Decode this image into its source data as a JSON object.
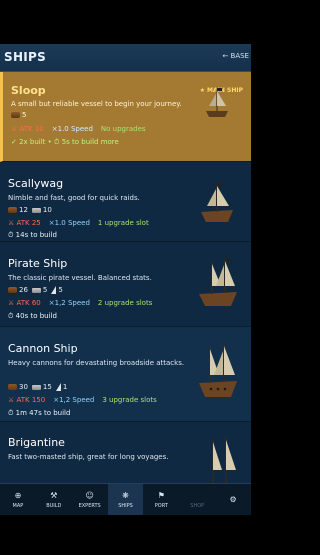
{
  "header": {
    "title": "SHIPS",
    "back_label": "← BASE"
  },
  "ships": [
    {
      "name": "Sloop",
      "badge": "★ MAIN SHIP",
      "description": "A small but reliable vessel to begin your journey.",
      "resources": [
        {
          "type": "log",
          "icon": "log-icon",
          "amount": "5"
        }
      ],
      "atk": "⚔ ATK  10",
      "speed": "×1.0 Speed",
      "upgrades": "No upgrades",
      "build": "✓ 2x built • ⏱ 5s to build more"
    },
    {
      "name": "Scallywag",
      "description": "Nimble and fast, good for quick raids.",
      "resources": [
        {
          "type": "log",
          "icon": "log-icon",
          "amount": "12"
        },
        {
          "type": "plank",
          "icon": "plank-icon",
          "amount": "10"
        }
      ],
      "atk": "⚔ ATK  25",
      "speed": "×1.0 Speed",
      "upgrades": "1 upgrade slot",
      "build": "⏱ 14s to build"
    },
    {
      "name": "Pirate Ship",
      "description": "The classic pirate vessel. Balanced stats.",
      "resources": [
        {
          "type": "log",
          "icon": "log-icon",
          "amount": "26"
        },
        {
          "type": "plank",
          "icon": "plank-icon",
          "amount": "5"
        },
        {
          "type": "sail",
          "icon": "sail-icon",
          "amount": "5"
        }
      ],
      "atk": "⚔ ATK  60",
      "speed": "×1,2 Speed",
      "upgrades": "2 upgrade slots",
      "build": "⏱ 40s to build"
    },
    {
      "name": "Cannon Ship",
      "description": "Heavy cannons for devastating broadside attacks.",
      "resources": [
        {
          "type": "log",
          "icon": "log-icon",
          "amount": "30"
        },
        {
          "type": "plank",
          "icon": "plank-icon",
          "amount": "15"
        },
        {
          "type": "sail",
          "icon": "sail-icon",
          "amount": "1"
        }
      ],
      "atk": "⚔ ATK  150",
      "speed": "×1,2 Speed",
      "upgrades": "3 upgrade slots",
      "build": "⏱ 1m 47s to build"
    },
    {
      "name": "Brigantine",
      "description": "Fast two-masted ship, great for long voyages."
    }
  ],
  "nav": [
    {
      "label": "MAP",
      "icon": "map-icon",
      "glyph": "⊕"
    },
    {
      "label": "BUILD",
      "icon": "hammer-icon",
      "glyph": "⚒"
    },
    {
      "label": "EXPERTS",
      "icon": "experts-icon",
      "glyph": "☺"
    },
    {
      "label": "SHIPS",
      "icon": "helm-icon",
      "glyph": "❋"
    },
    {
      "label": "PORT",
      "icon": "flag-icon",
      "glyph": "⚑"
    },
    {
      "label": "SHOP",
      "icon": "shop-icon",
      "glyph": ""
    },
    {
      "label": "",
      "icon": "settings-icon",
      "glyph": "⚙"
    }
  ],
  "colors": {
    "header": "#1c3a57",
    "selected_card": "#a47a33",
    "accent": "#f5c34b",
    "atk": "#ff6b4f",
    "speed": "#8fd3ff",
    "upgrade": "#a7e36e"
  }
}
